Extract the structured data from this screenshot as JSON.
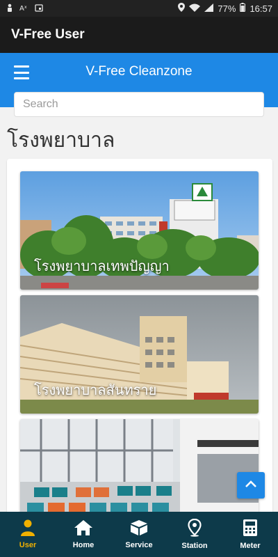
{
  "status_bar": {
    "battery": "77%",
    "time": "16:57"
  },
  "app_bar": {
    "title": "V-Free User"
  },
  "header": {
    "title": "V-Free Cleanzone"
  },
  "search": {
    "placeholder": "Search",
    "value": ""
  },
  "section": {
    "title": "โรงพยาบาล"
  },
  "hospitals": [
    {
      "name": "โรงพยาบาลเทพปัญญา"
    },
    {
      "name": "โรงพยาบาลสันทราย"
    },
    {
      "name": ""
    }
  ],
  "bottom_nav": {
    "items": [
      {
        "label": "User",
        "icon": "user-icon",
        "active": true
      },
      {
        "label": "Home",
        "icon": "home-icon",
        "active": false
      },
      {
        "label": "Service",
        "icon": "box-icon",
        "active": false
      },
      {
        "label": "Station",
        "icon": "location-pin-icon",
        "active": false
      },
      {
        "label": "Meter",
        "icon": "meter-icon",
        "active": false
      }
    ]
  },
  "colors": {
    "accent_blue": "#1e88e5",
    "app_bar": "#1b1b1b",
    "bottom_nav": "#0d3a4a",
    "active_nav": "#f0b000"
  }
}
